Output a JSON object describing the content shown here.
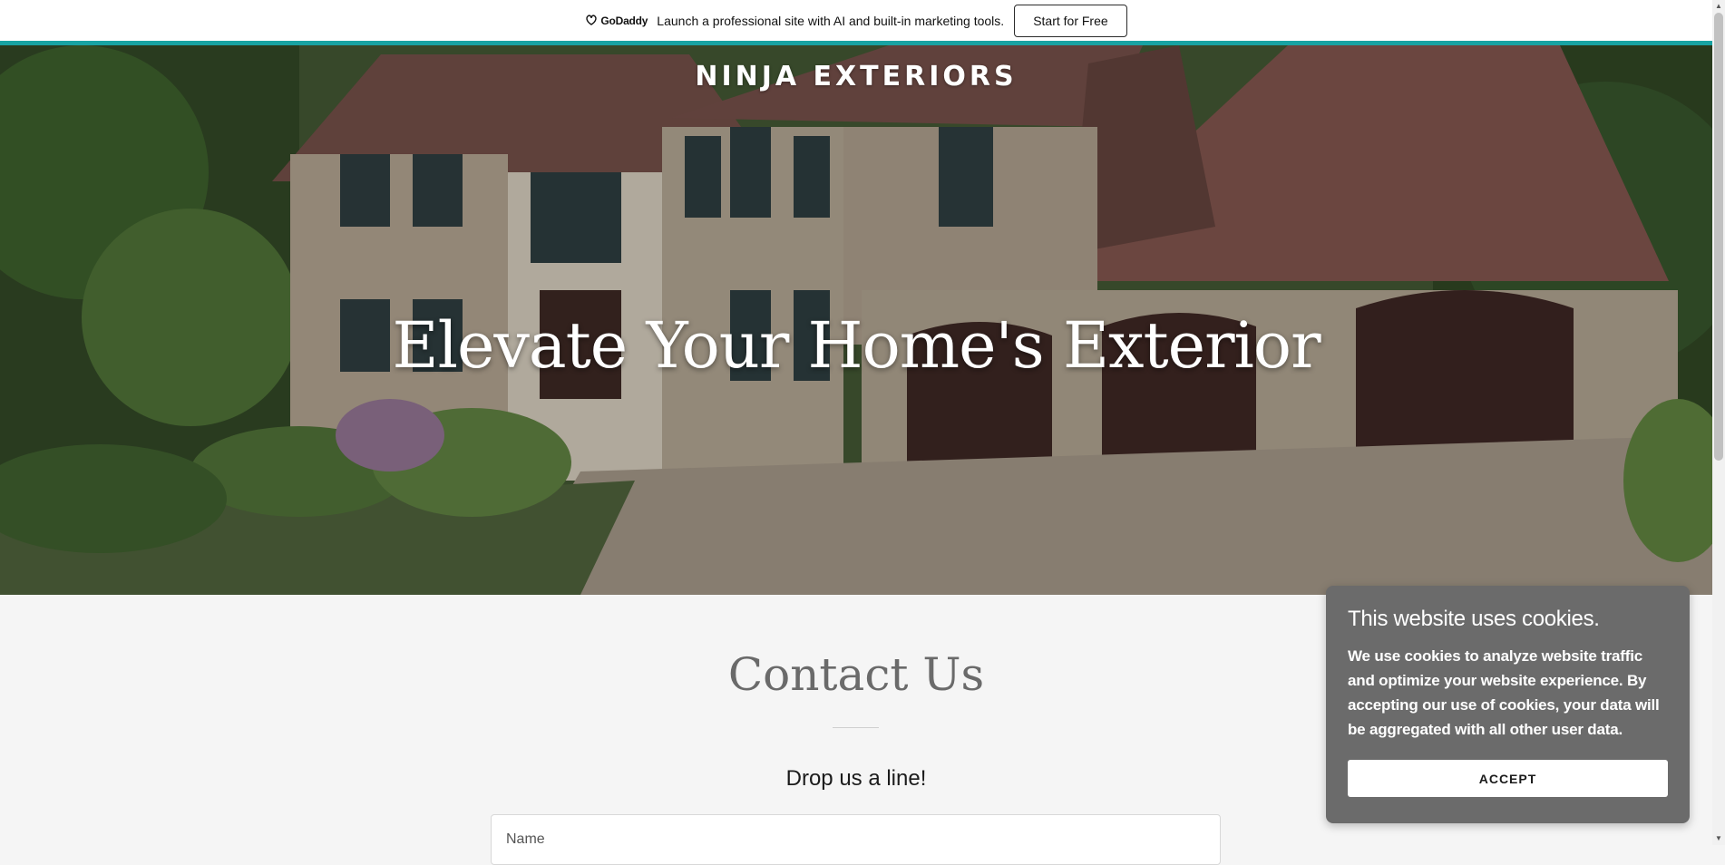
{
  "promo": {
    "logo_text": "GoDaddy",
    "message": "Launch a professional site with AI and built-in marketing tools.",
    "cta_label": "Start for Free"
  },
  "hero": {
    "brand": "NINJA EXTERIORS",
    "headline": "Elevate Your Home's Exterior"
  },
  "contact": {
    "title": "Contact Us",
    "subtitle": "Drop us a line!",
    "name_placeholder": "Name"
  },
  "cookie_banner": {
    "title": "This website uses cookies.",
    "body": "We use cookies to analyze website traffic and optimize your website experience. By accepting our use of cookies, your data will be aggregated with all other user data.",
    "accept_label": "ACCEPT"
  },
  "colors": {
    "accent_teal": "#18a3a3",
    "cookie_bg": "#6b6b6b",
    "page_bg": "#f5f5f5"
  }
}
